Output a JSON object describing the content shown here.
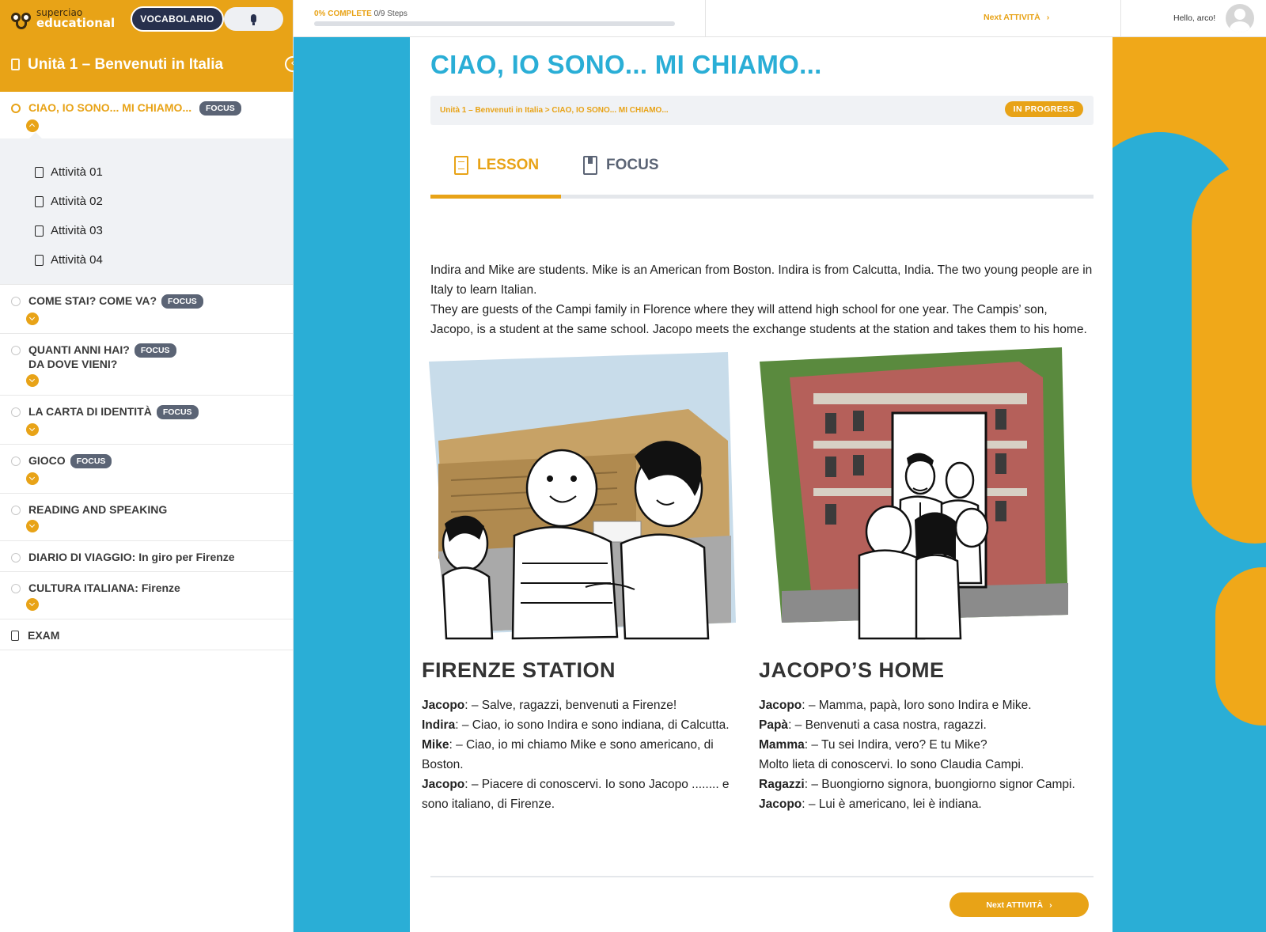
{
  "app": {
    "logo_small": "superciao",
    "logo_big": "educational",
    "vocab_button": "VOCABOLARIO"
  },
  "topbar": {
    "progress_percent_label": "0% COMPLETE",
    "progress_steps_label": "0/9 Steps",
    "progress_value": 0,
    "next_label": "Next ATTIVITÀ",
    "hello": "Hello, arco!"
  },
  "sidebar": {
    "unit_title": "Unità 1 – Benvenuti in Italia",
    "sections": [
      {
        "title": "CIAO, IO SONO... MI CHIAMO...",
        "focus": "FOCUS",
        "active": true,
        "expanded": true
      },
      {
        "title": "COME STAI? COME VA?",
        "focus": "FOCUS"
      },
      {
        "title": "QUANTI ANNI HAI?",
        "title2": "DA DOVE VIENI?",
        "focus": "FOCUS"
      },
      {
        "title": "LA CARTA DI IDENTITÀ",
        "focus": "FOCUS"
      },
      {
        "title": "GIOCO",
        "focus": "FOCUS"
      },
      {
        "title": "READING AND SPEAKING"
      },
      {
        "title": "DIARIO DI VIAGGIO: In giro per Firenze"
      },
      {
        "title": "CULTURA ITALIANA: Firenze"
      },
      {
        "title": "EXAM"
      }
    ],
    "activities": [
      "Attività 01",
      "Attività 02",
      "Attività 03",
      "Attività 04"
    ]
  },
  "lesson": {
    "title": "CIAO, IO SONO... MI CHIAMO...",
    "breadcrumb": "Unità 1 – Benvenuti in Italia > CIAO, IO SONO... MI CHIAMO...",
    "status": "IN PROGRESS",
    "tabs": [
      {
        "label": "LESSON",
        "active": true
      },
      {
        "label": "FOCUS",
        "active": false
      }
    ],
    "intro_p1": "Indira and Mike are students. Mike is an American from Boston. Indira is from Calcutta, India. The two young people are in Italy to learn Italian.",
    "intro_p2": "They are guests of the Campi family in Florence where they will attend high school for one year. The Campis’ son, Jacopo, is a student at the same school. Jacopo meets the exchange students at the station and takes them to his home.",
    "left": {
      "title": "FIRENZE STATION",
      "lines": [
        {
          "speaker": "Jacopo",
          "text": ": – Salve, ragazzi, benvenuti a Firenze!"
        },
        {
          "speaker": "Indira",
          "text": ": – Ciao, io sono Indira e sono indiana, di Calcutta."
        },
        {
          "speaker": "Mike",
          "text": ": – Ciao, io mi chiamo Mike e sono americano, di Boston."
        },
        {
          "speaker": "Jacopo",
          "text": ": – Piacere di conoscervi. Io sono Jacopo ........ e sono italiano, di Firenze."
        }
      ]
    },
    "right": {
      "title": "JACOPO’S HOME",
      "lines": [
        {
          "speaker": "Jacopo",
          "text": ": – Mamma, papà, loro sono Indira e Mike."
        },
        {
          "speaker": "Papà",
          "text": ": – Benvenuti a casa nostra, ragazzi."
        },
        {
          "speaker": "Mamma",
          "text": ": – Tu sei Indira, vero? E tu Mike?"
        },
        {
          "speaker": "",
          "text": "Molto lieta di conoscervi. Io sono Claudia Campi."
        },
        {
          "speaker": "Ragazzi",
          "text": ": – Buongiorno signora, buongiorno signor Campi."
        },
        {
          "speaker": "Jacopo",
          "text": ": – Lui è americano, lei è indiana."
        }
      ]
    },
    "next_button": "Next ATTIVITÀ"
  },
  "colors": {
    "accent": "#e8a317",
    "blue": "#2aaed6",
    "navy": "#27304d",
    "badge": "#5b6475"
  },
  "icons": {
    "logo": "owl-icon",
    "mic": "microphone-icon",
    "unit": "book-icon",
    "collapse": "chevron-left-icon",
    "activity": "document-icon",
    "lesson_tab": "document-icon",
    "focus_tab": "bookmark-icon"
  }
}
